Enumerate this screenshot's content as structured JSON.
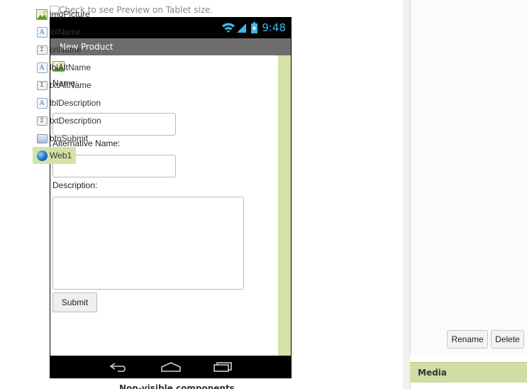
{
  "viewer": {
    "tablet_preview_label": "Check to see Preview on Tablet size.",
    "nonvisible_label": "Non-visible components"
  },
  "phone": {
    "status_time": "9:48",
    "screen_title": "New Product",
    "form": {
      "name_label": "Name:",
      "alt_name_label": "Alternative Name:",
      "description_label": "Description:",
      "submit_label": "Submit"
    }
  },
  "components": {
    "items": [
      {
        "name": "imgPicture",
        "icon": "image-icon"
      },
      {
        "name": "lblName",
        "icon": "label-icon"
      },
      {
        "name": "txtName",
        "icon": "textbox-icon"
      },
      {
        "name": "lblAltName",
        "icon": "label-icon"
      },
      {
        "name": "txtAltName",
        "icon": "textbox-icon"
      },
      {
        "name": "lblDescription",
        "icon": "label-icon"
      },
      {
        "name": "txtDescription",
        "icon": "textbox-icon"
      },
      {
        "name": "btnSubmit",
        "icon": "button-icon"
      },
      {
        "name": "Web1",
        "icon": "web-icon",
        "selected": true
      }
    ],
    "rename_label": "Rename",
    "delete_label": "Delete"
  },
  "media": {
    "header": "Media"
  },
  "colors": {
    "selection_green": "#d4e2a8",
    "status_blue": "#39b7e8",
    "title_bar_gray": "#6d6d6d"
  }
}
